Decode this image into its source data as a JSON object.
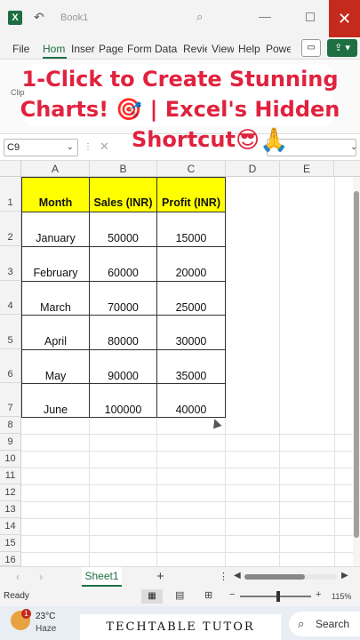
{
  "window": {
    "app_logo": "X",
    "title": "Book1",
    "close_glyph": "✕",
    "min_glyph": "—"
  },
  "ribbon": {
    "tabs": [
      "File",
      "Hom",
      "Inser",
      "Page",
      "Form",
      "Data",
      "Revie",
      "View",
      "Help",
      "Powe"
    ],
    "active_tab": "Hom",
    "clipboard_label": "Clip"
  },
  "overlay": {
    "line1": "1-Click to Create Stunning",
    "line2": "Charts! 🎯 | Excel's Hidden",
    "line3": "Shortcut",
    "emoji1": "😎",
    "emoji2": "🙏",
    "color": "#e0223e"
  },
  "formula_bar": {
    "name_box": "C9",
    "fx_cancel": "✕"
  },
  "sheet": {
    "columns": [
      "A",
      "B",
      "C",
      "D",
      "E"
    ],
    "row_numbers": [
      "1",
      "2",
      "3",
      "4",
      "5",
      "6",
      "7",
      "8",
      "9",
      "10",
      "11",
      "12",
      "13",
      "14",
      "15",
      "16"
    ],
    "table": {
      "headers": [
        "Month",
        "Sales (INR)",
        "Profit (INR)"
      ],
      "rows": [
        [
          "January",
          "50000",
          "15000"
        ],
        [
          "February",
          "60000",
          "20000"
        ],
        [
          "March",
          "70000",
          "25000"
        ],
        [
          "April",
          "80000",
          "30000"
        ],
        [
          "May",
          "90000",
          "35000"
        ],
        [
          "June",
          "100000",
          "40000"
        ]
      ],
      "header_fill": "#ffff00"
    }
  },
  "sheet_tabs": {
    "active": "Sheet1",
    "add": "+"
  },
  "status": {
    "ready": "Ready",
    "zoom": "115%"
  },
  "taskbar": {
    "weather_badge": "1",
    "temp": "23°C",
    "condition": "Haze",
    "watermark": "TECHTABLE TUTOR",
    "search": "Search"
  }
}
